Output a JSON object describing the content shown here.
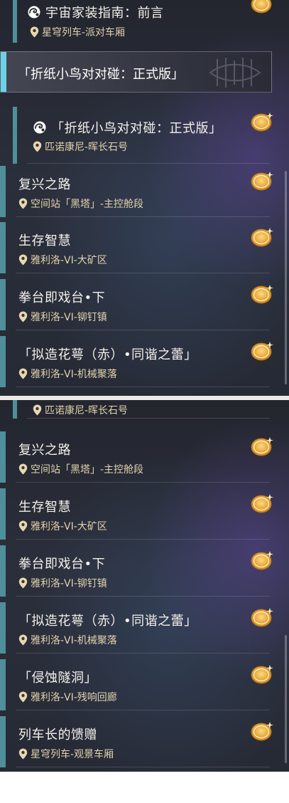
{
  "top_list": {
    "partial_item": {
      "title": "宇宙家装指南：前言",
      "location": "星穹列车-派对车厢",
      "badge": "新",
      "icon": "swirl-mission-icon"
    },
    "selected_item": {
      "title": "「折纸小鸟对对碰：正式版」"
    },
    "items": [
      {
        "title": "「折纸小鸟对对碰：正式版」",
        "location": "匹诺康尼-晖长石号",
        "badge": "新",
        "icon": "swirl-mission-icon"
      },
      {
        "title": "复兴之路",
        "location": "空间站「黑塔」-主控舱段",
        "badge": "新"
      },
      {
        "title": "生存智慧",
        "location": "雅利洛-VI-大矿区",
        "badge": "新"
      },
      {
        "title": "拳台即戏台•下",
        "location": "雅利洛-VI-铆钉镇",
        "badge": "新"
      },
      {
        "title": "「拟造花萼（赤）•同谐之蕾」",
        "location": "雅利洛-VI-机械聚落",
        "badge": "新"
      }
    ]
  },
  "bottom_list": {
    "partial_location": "匹诺康尼-晖长石号",
    "items": [
      {
        "title": "复兴之路",
        "location": "空间站「黑塔」-主控舱段",
        "badge": "新"
      },
      {
        "title": "生存智慧",
        "location": "雅利洛-VI-大矿区",
        "badge": "新"
      },
      {
        "title": "拳台即戏台•下",
        "location": "雅利洛-VI-铆钉镇",
        "badge": "新"
      },
      {
        "title": "「拟造花萼（赤）•同谐之蕾」",
        "location": "雅利洛-VI-机械聚落",
        "badge": "新"
      },
      {
        "title": "「侵蚀隧洞」",
        "location": "雅利洛-VI-残响回廊",
        "badge": "新"
      },
      {
        "title": "列车长的馈赠",
        "location": "星穹列车-观景车厢",
        "badge": "新"
      }
    ]
  },
  "colors": {
    "accent": "#4e8f9a",
    "selected_accent": "#6fd2e6",
    "location_text": "#e3d2ad",
    "badge": "#f0b441"
  }
}
